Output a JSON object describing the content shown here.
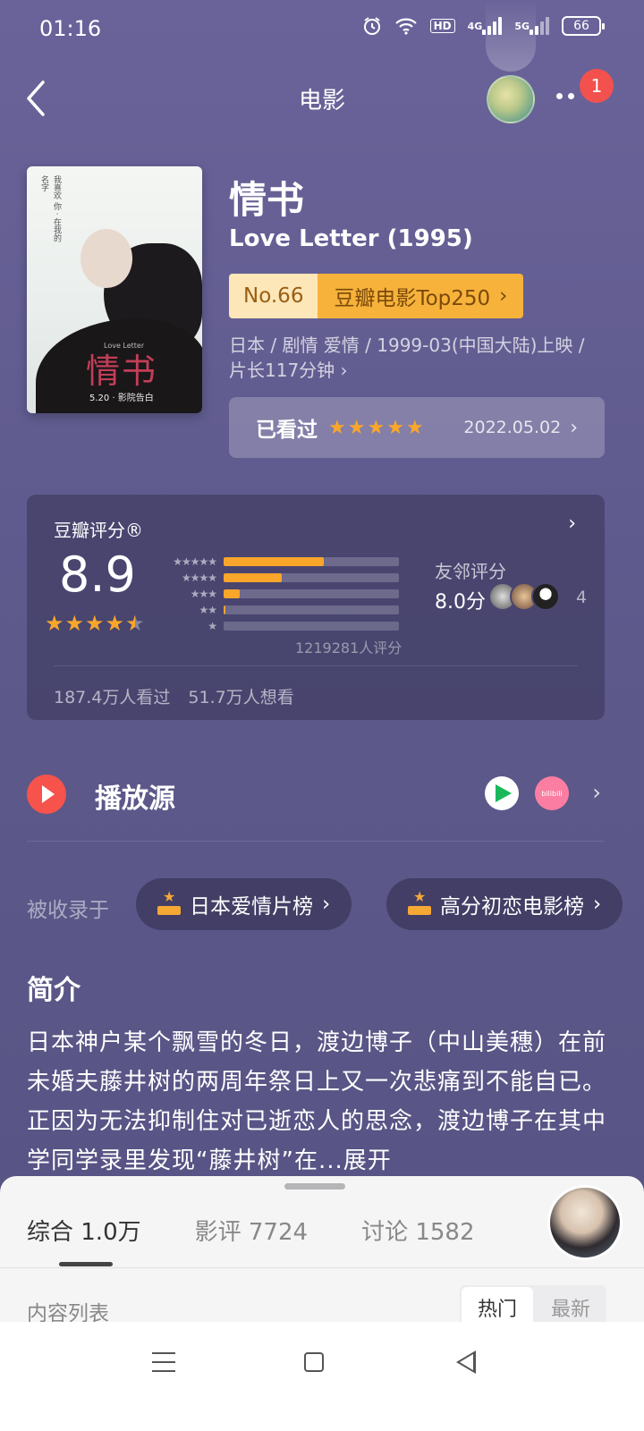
{
  "status": {
    "time": "01:16",
    "hd": "HD",
    "net1": "4G",
    "net2": "5G",
    "battery": "66"
  },
  "header": {
    "title": "电影",
    "notification_count": "1"
  },
  "poster": {
    "title_art": "情书",
    "subtitle_art": "Love Letter",
    "date_art": "5.20 · 影院告白",
    "tagline_art": "我喜欢 你 · 在我的名字"
  },
  "movie": {
    "title_cn": "情书",
    "title_en": "Love Letter (1995)",
    "rank_no": "No.66",
    "rank_list": "豆瓣电影Top250",
    "meta_line1": "日本 / 剧情 爱情 / 1999-03(中国大陆)上映 /",
    "meta_line2": "片长117分钟",
    "watched_label": "已看过",
    "watched_stars": 5,
    "watched_date": "2022.05.02"
  },
  "rating": {
    "title": "豆瓣评分®",
    "score": "8.9",
    "stars": 4.5,
    "distribution": [
      {
        "stars": "★★★★★",
        "fraction": 0.57
      },
      {
        "stars": "★★★★",
        "fraction": 0.33
      },
      {
        "stars": "★★★",
        "fraction": 0.09
      },
      {
        "stars": "★★",
        "fraction": 0.01
      },
      {
        "stars": "★",
        "fraction": 0.0
      }
    ],
    "count": "1219281人评分",
    "friend_title": "友邻评分",
    "friend_score": "8.0分",
    "friend_count": "4",
    "watched_count": "187.4万人看过",
    "want_count": "51.7万人想看"
  },
  "play": {
    "label": "播放源",
    "sources": [
      "tencent-video-icon",
      "bilibili-icon"
    ],
    "bili_text": "bilibili"
  },
  "collected": {
    "label": "被收录于",
    "chips": [
      "日本爱情片榜",
      "高分初恋电影榜"
    ]
  },
  "synopsis": {
    "title": "简介",
    "text": "日本神户某个飘雪的冬日，渡边博子（中山美穗）在前未婚夫藤井树的两周年祭日上又一次悲痛到不能自已。正因为无法抑制住对已逝恋人的思念，渡边博子在其中学同学录里发现“藤井树”在...展开"
  },
  "sheet": {
    "tabs": [
      "综合 1.0万",
      "影评 7724",
      "讨论 1582"
    ],
    "content_list": "内容列表",
    "sort_options": [
      "热门",
      "最新"
    ]
  },
  "colors": {
    "accent": "#f9a62b",
    "background": "#5d598b",
    "play_red": "#f5534b"
  }
}
